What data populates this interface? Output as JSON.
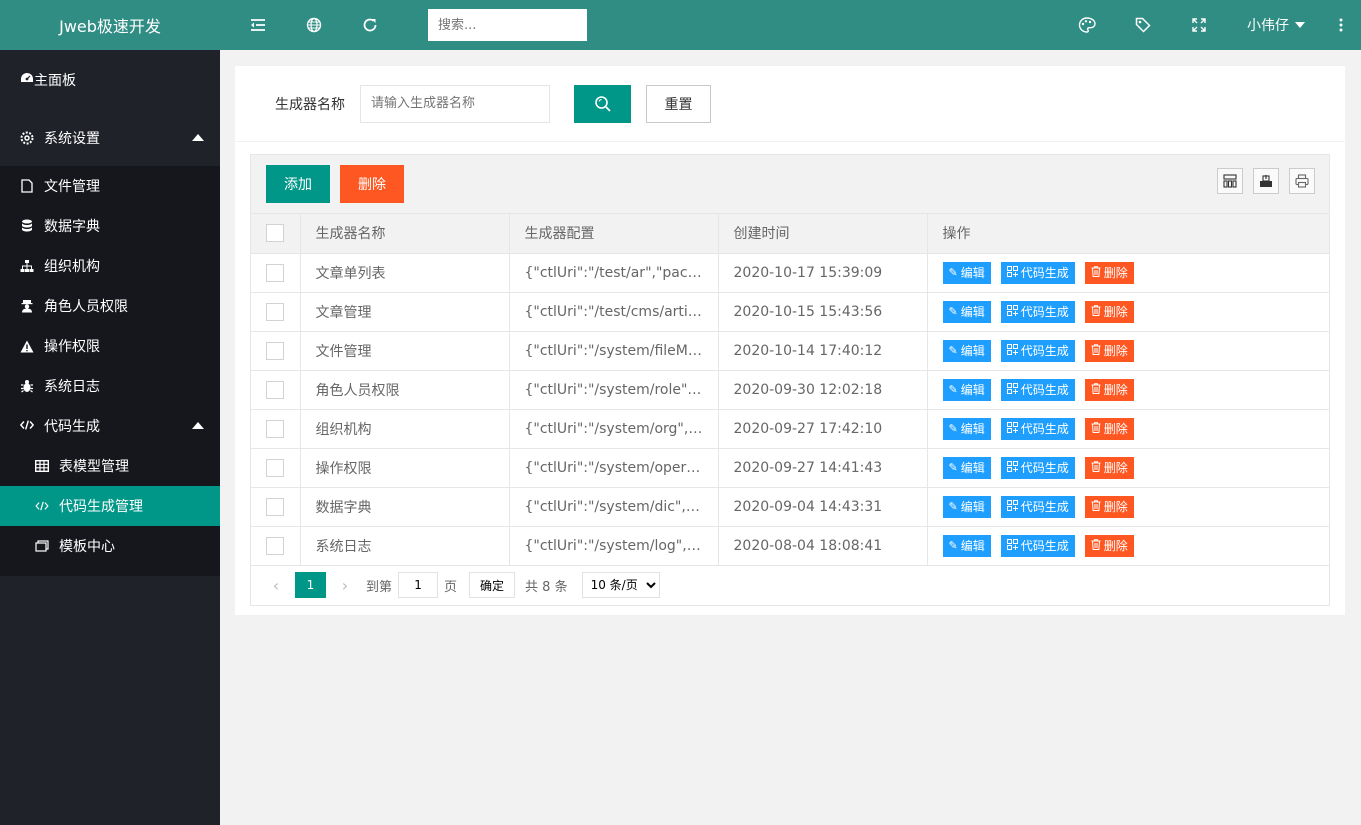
{
  "brand": "Jweb极速开发",
  "header": {
    "search_placeholder": "搜索...",
    "user": "小伟仔"
  },
  "sidebar": {
    "dashboard": "主面板",
    "settings": "系统设置",
    "settings_items": [
      "文件管理",
      "数据字典",
      "组织机构",
      "角色人员权限",
      "操作权限",
      "系统日志"
    ],
    "codegen": "代码生成",
    "codegen_items": [
      "表模型管理",
      "代码生成管理",
      "模板中心"
    ]
  },
  "filter": {
    "label": "生成器名称",
    "placeholder": "请输入生成器名称",
    "reset": "重置"
  },
  "toolbar": {
    "add": "添加",
    "delete": "删除"
  },
  "table": {
    "headers": [
      "生成器名称",
      "生成器配置",
      "创建时间",
      "操作"
    ],
    "rows": [
      {
        "name": "文章单列表",
        "config": "{\"ctlUri\":\"/test/ar\",\"packag…",
        "time": "2020-10-17 15:39:09"
      },
      {
        "name": "文章管理",
        "config": "{\"ctlUri\":\"/test/cms/article\",…",
        "time": "2020-10-15 15:43:56"
      },
      {
        "name": "文件管理",
        "config": "{\"ctlUri\":\"/system/fileMgr\",\"…",
        "time": "2020-10-14 17:40:12"
      },
      {
        "name": "角色人员权限",
        "config": "{\"ctlUri\":\"/system/role\",\"pa…",
        "time": "2020-09-30 12:02:18"
      },
      {
        "name": "组织机构",
        "config": "{\"ctlUri\":\"/system/org\",\"pa…",
        "time": "2020-09-27 17:42:10"
      },
      {
        "name": "操作权限",
        "config": "{\"ctlUri\":\"/system/oper\",\"p…",
        "time": "2020-09-27 14:41:43"
      },
      {
        "name": "数据字典",
        "config": "{\"ctlUri\":\"/system/dic\",\"pac…",
        "time": "2020-09-04 14:43:31"
      },
      {
        "name": "系统日志",
        "config": "{\"ctlUri\":\"/system/log\",\"pac…",
        "time": "2020-08-04 18:08:41"
      }
    ],
    "ops": {
      "edit": "编辑",
      "gen": "代码生成",
      "del": "删除"
    }
  },
  "pager": {
    "current": "1",
    "goto": "到第",
    "page_input": "1",
    "page_unit": "页",
    "confirm": "确定",
    "total": "共 8 条",
    "per_page": "10 条/页"
  },
  "colors": {
    "primary": "#009688",
    "header": "#2f8d84",
    "danger": "#ff5722",
    "info": "#1e9fff",
    "sidebar": "#20222a"
  }
}
